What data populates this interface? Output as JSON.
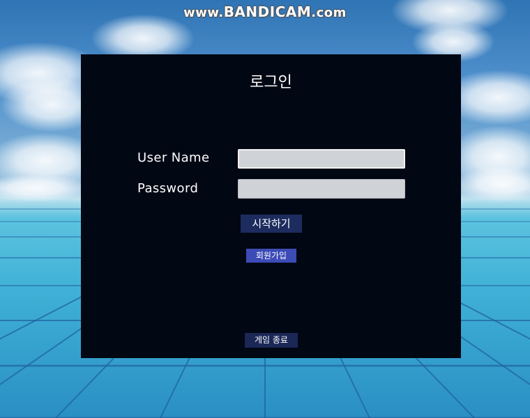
{
  "watermark": {
    "prefix": "www.",
    "brand": "BANDICAM",
    "suffix": ".com"
  },
  "login": {
    "title": "로그인",
    "username_label": "User Name",
    "username_value": "",
    "password_label": "Password",
    "password_value": "",
    "start_button": "시작하기",
    "signup_button": "회원가입",
    "quit_button": "게임 종료"
  },
  "colors": {
    "panel_bg": "#020714",
    "start_button_bg": "#1d2c5e",
    "signup_button_bg": "#3c4bb6",
    "quit_button_bg": "#1b2856",
    "input_bg": "#cfd2d6"
  }
}
